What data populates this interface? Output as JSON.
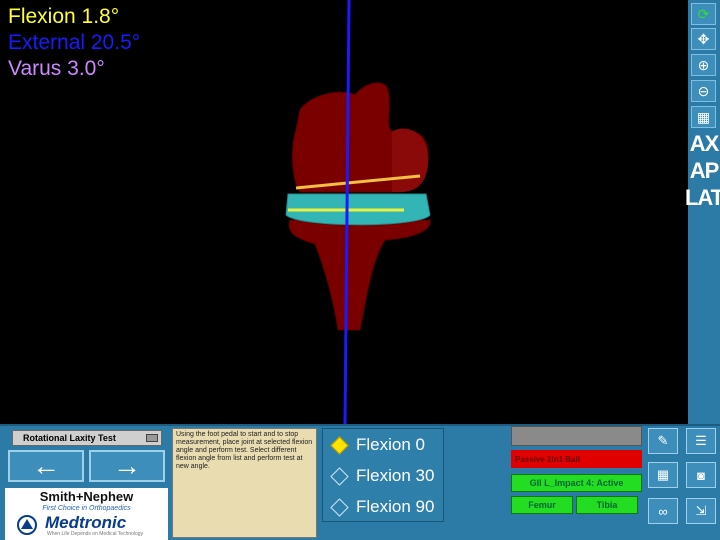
{
  "readouts": {
    "flexion": "Flexion 1.8°",
    "external": "External 20.5°",
    "varus": "Varus 3.0°"
  },
  "colors": {
    "flexion": "#ffff33",
    "external": "#1a1aff",
    "varus": "#cc88ff",
    "panel_bg": "#2c7aa6",
    "bone": "#7a0000",
    "implant": "#33b5b5",
    "axis": "#1a1aff"
  },
  "toolbar": {
    "icons": [
      "refresh-icon",
      "move-icon",
      "zoom-in-icon",
      "zoom-out-icon",
      "view-icon"
    ],
    "views": [
      "AX",
      "AP",
      "LAT"
    ]
  },
  "test_selector": {
    "value": "Rotational Laxity Test"
  },
  "nav": {
    "prev": "←",
    "next": "→"
  },
  "logos": {
    "smith_nephew": "Smith+Nephew",
    "smith_nephew_tagline": "First Choice in Orthopaedics",
    "medtronic": "Medtronic",
    "medtronic_tagline": "When Life Depends on Medical Technology"
  },
  "instructions": "Using the foot pedal to start and to stop measurement, place joint at selected flexion angle and perform test. Select different flexion angle from list and perform test at new angle.",
  "flexion_options": [
    {
      "label": "Flexion 0",
      "selected": true
    },
    {
      "label": "Flexion 30",
      "selected": false
    },
    {
      "label": "Flexion 90",
      "selected": false
    }
  ],
  "status": {
    "field": "",
    "passive": "Passive 2in1 Ball",
    "device": "GII L_Impact 4: Active",
    "femur": "Femur",
    "tibia": "Tibia"
  },
  "side_buttons": [
    "tool-icon",
    "list-icon",
    "grid-icon",
    "camera-icon",
    "glasses-icon",
    "export-icon"
  ]
}
